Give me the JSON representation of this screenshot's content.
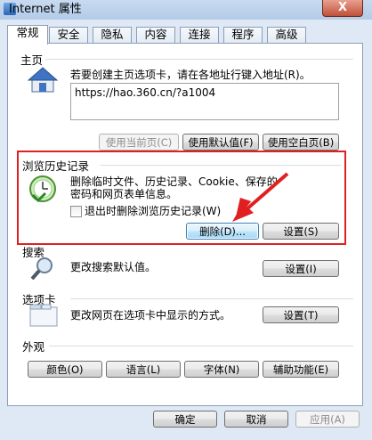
{
  "window": {
    "title": "Internet 属性",
    "close_label": "X"
  },
  "tabs": [
    "常规",
    "安全",
    "隐私",
    "内容",
    "连接",
    "程序",
    "高级"
  ],
  "home": {
    "section_title": "主页",
    "description": "若要创建主页选项卡，请在各地址行键入地址(R)。",
    "url": "https://hao.360.cn/?a1004",
    "use_current": "使用当前页(C)",
    "use_default": "使用默认值(F)",
    "use_blank": "使用空白页(B)"
  },
  "history": {
    "section_title": "浏览历史记录",
    "description": "删除临时文件、历史记录、Cookie、保存的密码和网页表单信息。",
    "checkbox_label": "退出时删除浏览历史记录(W)",
    "delete_button": "删除(D)...",
    "settings_button": "设置(S)"
  },
  "search": {
    "section_title": "搜索",
    "description": "更改搜索默认值。",
    "settings_button": "设置(I)"
  },
  "tabs_section": {
    "section_title": "选项卡",
    "description": "更改网页在选项卡中显示的方式。",
    "settings_button": "设置(T)"
  },
  "appearance": {
    "section_title": "外观",
    "colors": "颜色(O)",
    "languages": "语言(L)",
    "fonts": "字体(N)",
    "accessibility": "辅助功能(E)"
  },
  "footer": {
    "ok": "确定",
    "cancel": "取消",
    "apply": "应用(A)"
  },
  "colors": {
    "highlight": "#e02020",
    "arrow": "#e02020"
  }
}
